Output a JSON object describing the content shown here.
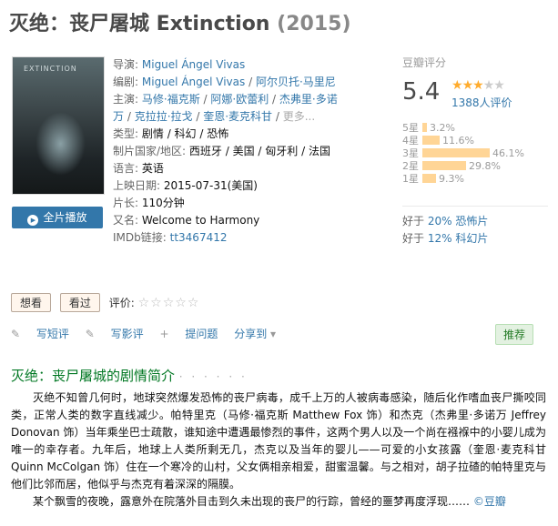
{
  "title": {
    "name": "灭绝：丧尸屠城 Extinction",
    "year": "(2015)"
  },
  "poster": {
    "caption": "EXTINCTION"
  },
  "play_button": "全片播放",
  "play_icon": "▶",
  "info": {
    "director": {
      "label": "导演:",
      "value": "Miguel Ángel Vivas"
    },
    "writers": {
      "label": "编剧:",
      "names": [
        "Miguel Ángel Vivas",
        "阿尔贝托·马里尼"
      ]
    },
    "cast": {
      "label": "主演:",
      "line1": [
        "马修·福克斯",
        "阿娜·欧蕾利",
        "杰弗里·多诺"
      ],
      "line2": [
        "万",
        "克拉拉·拉戈",
        "奎恩·麦克科甘"
      ],
      "more": "更多..."
    },
    "genre": {
      "label": "类型:",
      "value": "剧情 / 科幻 / 恐怖"
    },
    "country": {
      "label": "制片国家/地区:",
      "value": "西班牙 / 美国 / 匈牙利 / 法国"
    },
    "language": {
      "label": "语言:",
      "value": "英语"
    },
    "release": {
      "label": "上映日期:",
      "value": "2015-07-31(美国)"
    },
    "runtime": {
      "label": "片长:",
      "value": "110分钟"
    },
    "aka": {
      "label": "又名:",
      "value": "Welcome to Harmony"
    },
    "imdb": {
      "label": "IMDb链接:",
      "value": "tt3467412"
    }
  },
  "rating": {
    "label": "豆瓣评分",
    "score": "5.4",
    "stars": 3,
    "votes": "1388人评价",
    "breakdown": [
      {
        "k": "5星",
        "pct": "3.2%",
        "v": 3.2
      },
      {
        "k": "4星",
        "pct": "11.6%",
        "v": 11.6
      },
      {
        "k": "3星",
        "pct": "46.1%",
        "v": 46.1
      },
      {
        "k": "2星",
        "pct": "29.8%",
        "v": 29.8
      },
      {
        "k": "1星",
        "pct": "9.3%",
        "v": 9.3
      }
    ],
    "better": [
      {
        "prefix": "好于",
        "link": "20% 恐怖片"
      },
      {
        "prefix": "好于",
        "link": "12% 科幻片"
      }
    ]
  },
  "interest": {
    "want": "想看",
    "seen": "看过",
    "rate_label": "评价:"
  },
  "actions": {
    "short_review": "写短评",
    "review": "写影评",
    "question": "提问题",
    "share": "分享到",
    "recommend": "推荐"
  },
  "summary": {
    "heading": "灭绝：丧尸屠城的剧情简介",
    "dots": "· · · · · ·",
    "para1": "灭绝不知曾几何时，地球突然爆发恐怖的丧尸病毒，成千上万的人被病毒感染，随后化作嗜血丧尸撕咬同类，正常人类的数字直线减少。帕特里克（马修·福克斯 Matthew Fox 饰）和杰克（杰弗里·多诺万 Jeffrey Donovan 饰）当年乘坐巴士疏散，谁知途中遭遇最惨烈的事件，这两个男人以及一个尚在襁褓中的小婴儿成为唯一的幸存者。九年后，地球上人类所剩无几，杰克以及当年的婴儿——可爱的小女孩露（奎恩·麦克科甘 Quinn McColgan 饰）住在一个寒冷的山村，父女俩相亲相爱，甜蜜温馨。与之相对，胡子拉碴的帕特里克与他们比邻而居，他似乎与杰克有着深深的隔膜。",
    "para2": "某个飘雪的夜晚，露意外在院落外目击到久未出现的丧尸的行踪，曾经的噩梦再度浮现……",
    "credit": "©豆瓣"
  }
}
